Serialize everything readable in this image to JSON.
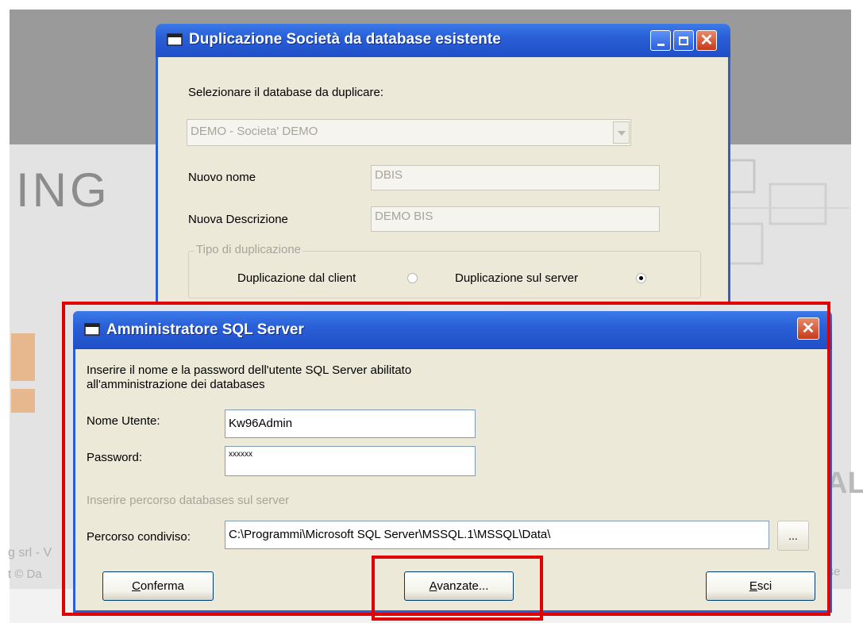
{
  "background": {
    "logo_text": "ING",
    "brand_text": "AL",
    "footer_company": "g srl - V",
    "footer_copyright": "t © Da",
    "footer_right": "i se"
  },
  "dup_window": {
    "title": "Duplicazione Società da database esistente",
    "select_label": "Selezionare il database da duplicare:",
    "database_value": "DEMO - Societa' DEMO",
    "nuovo_nome_label": "Nuovo nome",
    "nuovo_nome_value": "DBIS",
    "nuova_descrizione_label": "Nuova Descrizione",
    "nuova_descrizione_value": "DEMO BIS",
    "tipo_group_label": "Tipo di duplicazione",
    "radio_client_label": "Duplicazione dal client",
    "radio_server_label": "Duplicazione sul server",
    "selected_option": "server"
  },
  "sql_dialog": {
    "title": "Amministratore SQL Server",
    "instruction_line1": "Inserire il nome e la password dell'utente SQL Server abilitato",
    "instruction_line2": "all'amministrazione dei databases",
    "username_label": "Nome Utente:",
    "username_value": "Kw96Admin",
    "password_label": "Password:",
    "password_value": "xxxxxx",
    "path_hint": "Inserire percorso databases sul server",
    "path_label": "Percorso condiviso:",
    "path_value": "C:\\Programmi\\Microsoft SQL Server\\MSSQL.1\\MSSQL\\Data\\",
    "browse_label": "...",
    "confirm_label": "Conferma",
    "advanced_label": "Avanzate...",
    "exit_label": "Esci"
  },
  "colors": {
    "highlight": "#e00000",
    "titlebar": "#2a5fd8",
    "window_face": "#ece9d8"
  },
  "icons": {
    "title_icon": "window-icon",
    "minimize": "minimize-icon",
    "maximize": "maximize-icon",
    "close": "close-icon"
  }
}
